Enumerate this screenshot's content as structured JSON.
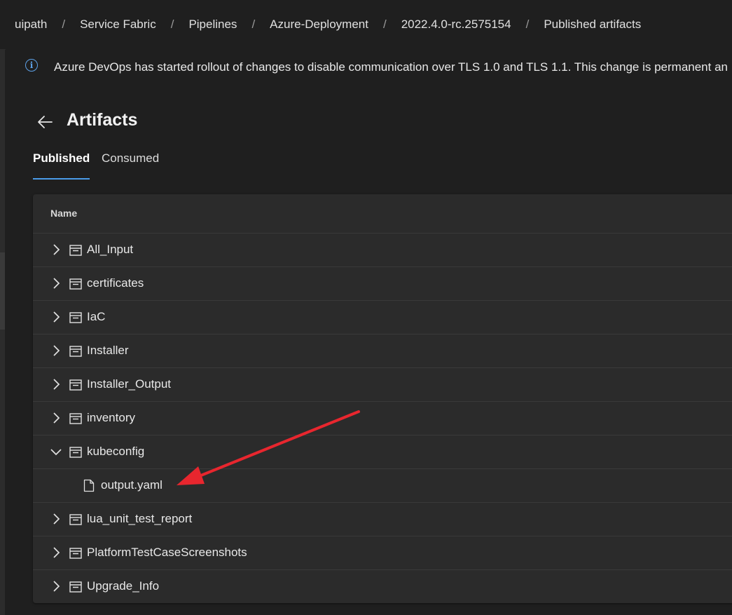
{
  "breadcrumb": [
    "uipath",
    "Service Fabric",
    "Pipelines",
    "Azure-Deployment",
    "2022.4.0-rc.2575154",
    "Published artifacts"
  ],
  "banner": {
    "icon": "info-icon",
    "text": "Azure DevOps has started rollout of changes to disable communication over TLS 1.0 and TLS 1.1. This change is permanent an"
  },
  "page": {
    "title": "Artifacts"
  },
  "tabs": {
    "published": "Published",
    "consumed": "Consumed",
    "selected": "Published"
  },
  "table": {
    "column_name": "Name",
    "rows": [
      {
        "label": "All_Input",
        "type": "folder",
        "expanded": false
      },
      {
        "label": "certificates",
        "type": "folder",
        "expanded": false
      },
      {
        "label": "IaC",
        "type": "folder",
        "expanded": false
      },
      {
        "label": "Installer",
        "type": "folder",
        "expanded": false
      },
      {
        "label": "Installer_Output",
        "type": "folder",
        "expanded": false
      },
      {
        "label": "inventory",
        "type": "folder",
        "expanded": false
      },
      {
        "label": "kubeconfig",
        "type": "folder",
        "expanded": true
      },
      {
        "label": "output.yaml",
        "type": "file"
      },
      {
        "label": "lua_unit_test_report",
        "type": "folder",
        "expanded": false
      },
      {
        "label": "PlatformTestCaseScreenshots",
        "type": "folder",
        "expanded": false
      },
      {
        "label": "Upgrade_Info",
        "type": "folder",
        "expanded": false
      }
    ]
  },
  "colors": {
    "accent": "#4a9be8",
    "annotation_arrow": "#e8262e",
    "background": "#1f1f1f",
    "panel": "#2b2b2b"
  }
}
